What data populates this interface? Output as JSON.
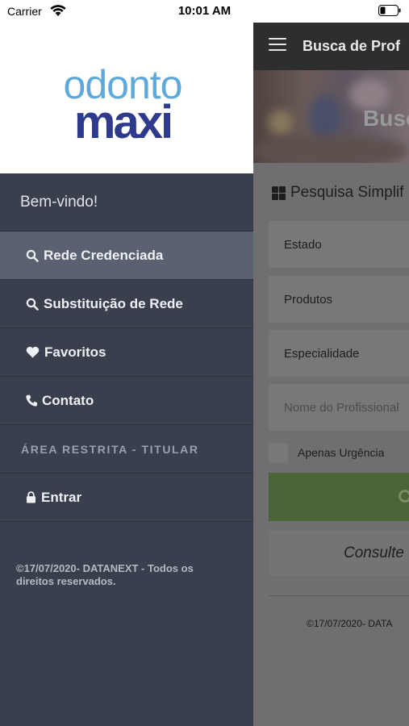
{
  "status_bar": {
    "carrier": "Carrier",
    "time": "10:01 AM"
  },
  "drawer": {
    "logo": {
      "line1": "odonto",
      "line2": "maxi"
    },
    "welcome": "Bem-vindo!",
    "menu_items": [
      {
        "label": "Rede Credenciada",
        "icon": "search-icon",
        "active": true
      },
      {
        "label": "Substituição de Rede",
        "icon": "search-icon",
        "active": false
      },
      {
        "label": "Favoritos",
        "icon": "heart-icon",
        "active": false
      },
      {
        "label": "Contato",
        "icon": "phone-icon",
        "active": false
      }
    ],
    "restricted_section": "ÁREA RESTRITA - TITULAR",
    "login_item": {
      "label": "Entrar",
      "icon": "lock-icon"
    },
    "footer": "©17/07/2020- DATANEXT - Todos os direitos reservados."
  },
  "main": {
    "appbar_title": "Busca de Prof",
    "hero_title": "Busc",
    "search_header": "Pesquisa Simplif",
    "fields": {
      "estado": "Estado",
      "produtos": "Produtos",
      "especialidade": "Especialidade",
      "nome_placeholder": "Nome do Profissional"
    },
    "urgency_label": "Apenas Urgência",
    "consult_label": "Consulte",
    "footer": "©17/07/2020- DATA"
  },
  "colors": {
    "drawer_bg": "#3a3f4e",
    "active_item_bg": "#5a6170",
    "logo_light_blue": "#5fa8dc",
    "logo_dark_blue": "#2e3a8c",
    "search_button": "#4b6435"
  }
}
